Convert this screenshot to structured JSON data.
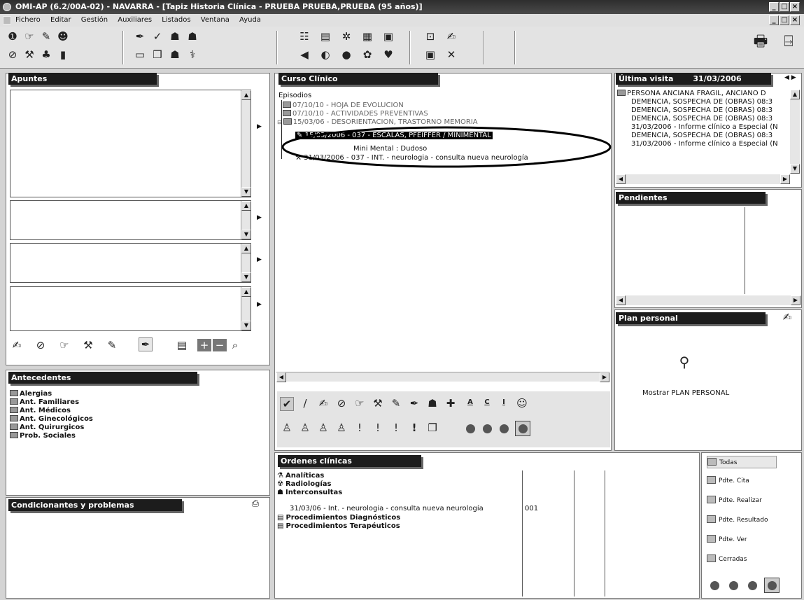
{
  "window": {
    "title": "OMI-AP (6.2/00A-02) - NAVARRA - [Tapiz Historia Clínica - PRUEBA PRUEBA,PRUEBA (95 años)]"
  },
  "menu": [
    "Fichero",
    "Editar",
    "Gestión",
    "Auxiliares",
    "Listados",
    "Ventana",
    "Ayuda"
  ],
  "apuntes": {
    "title": "Apuntes"
  },
  "antecedentes": {
    "title": "Antecedentes",
    "items": [
      "Alergias",
      "Ant. Familiares",
      "Ant. Médicos",
      "Ant. Ginecológicos",
      "Ant. Quirurgicos",
      "Prob. Sociales"
    ]
  },
  "condicionantes": {
    "title": "Condicionantes y problemas"
  },
  "curso": {
    "title": "Curso Clínico",
    "root": "Episodios",
    "items": [
      "07/10/10 - HOJA DE EVOLUCION",
      "07/10/10 - ACTIVIDADES PREVENTIVAS",
      "15/03/06 - DESORIENTACION, TRASTORNO MEMORIA",
      "15/03/2006 - 037 - ESCALAS, PFEIFFER / MINIMENTAL",
      "Mini Mental : Dudoso",
      "31/03/2006 - 037 - INT. - neurologia - consulta nueva neurología"
    ],
    "letters": [
      "A",
      "C",
      "I"
    ]
  },
  "ultima": {
    "title": "Última visita",
    "date": "31/03/2006",
    "items": [
      "PERSONA ANCIANA FRAGIL, ANCIANO D",
      "DEMENCIA, SOSPECHA DE (OBRAS) 08:3",
      "DEMENCIA, SOSPECHA DE (OBRAS) 08:3",
      "DEMENCIA, SOSPECHA DE (OBRAS) 08:3",
      "31/03/2006 - Informe clínico a Especial (N",
      "DEMENCIA, SOSPECHA DE (OBRAS) 08:3",
      "31/03/2006 - Informe clínico a Especial (N"
    ]
  },
  "pendientes": {
    "title": "Pendientes"
  },
  "plan": {
    "title": "Plan personal",
    "link": "Mostrar PLAN PERSONAL"
  },
  "ordenes": {
    "title": "Ordenes clínicas",
    "cats": [
      "Analíticas",
      "Radiologías",
      "Interconsultas"
    ],
    "row": {
      "text": "31/03/06 - Int. - neurologia - consulta nueva neurología",
      "code": "001"
    },
    "cats2": [
      "Procedimientos Diagnósticos",
      "Procedimientos Terapéuticos"
    ]
  },
  "filters": [
    "Todas",
    "Pdte. Cita",
    "Pdte. Realizar",
    "Pdte. Resultado",
    "Pdte. Ver",
    "Cerradas"
  ]
}
